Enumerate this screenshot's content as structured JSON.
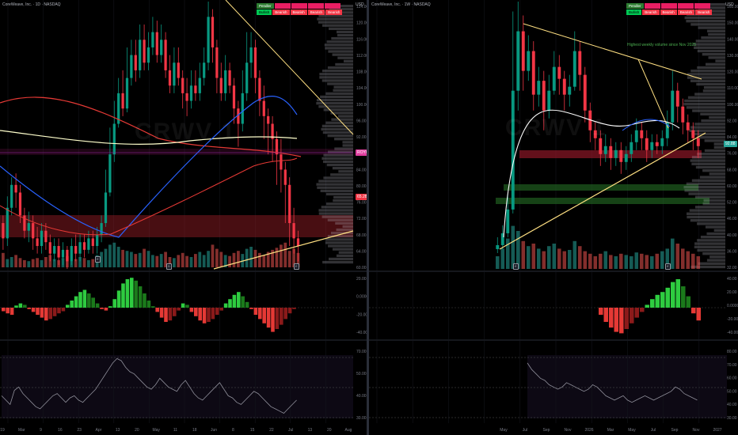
{
  "left": {
    "symbol_title": "CoreWeave, Inc. · 1D · NASDAQ",
    "currency": "USD",
    "watermark": "CRWV 1",
    "trend_panel": {
      "header": [
        "Pendler",
        "",
        "",
        "",
        ""
      ],
      "states": [
        "Bullish",
        "Bearish",
        "Bearish",
        "Bearish",
        "Bearish"
      ]
    },
    "price_ticks": [
      "124.00",
      "120.00",
      "116.00",
      "112.00",
      "108.00",
      "104.00",
      "100.00",
      "96.00",
      "92.00",
      "88.00",
      "84.00",
      "80.00",
      "76.00",
      "72.00",
      "68.00",
      "64.00",
      "60.00"
    ],
    "price_tag_1": "ROYCH",
    "price_tag_2": "65.28",
    "x_labels": [
      "19",
      "Mar",
      "9",
      "16",
      "23",
      "Apr",
      "13",
      "20",
      "May",
      "11",
      "18",
      "Jun",
      "8",
      "15",
      "22",
      "Jul",
      "13",
      "20",
      "Aug"
    ],
    "osc_ticks": [
      "20.00",
      "0.0000",
      "-20.00",
      "-40.00"
    ],
    "rsi_ticks": [
      "70.00",
      "50.00",
      "40.00",
      "30.00"
    ],
    "candles": [
      [
        70,
        66,
        72,
        63
      ],
      [
        66,
        74,
        77,
        64
      ],
      [
        74,
        80,
        82,
        72
      ],
      [
        80,
        78,
        83,
        74
      ],
      [
        78,
        72,
        80,
        70
      ],
      [
        72,
        68,
        74,
        66
      ],
      [
        68,
        70,
        73,
        65
      ],
      [
        70,
        66,
        72,
        63
      ],
      [
        66,
        64,
        69,
        62
      ],
      [
        64,
        68,
        70,
        62
      ],
      [
        68,
        65,
        70,
        63
      ],
      [
        65,
        62,
        67,
        60
      ],
      [
        62,
        64,
        66,
        60
      ],
      [
        64,
        61,
        66,
        59
      ],
      [
        61,
        63,
        65,
        59
      ],
      [
        63,
        60,
        64,
        58
      ],
      [
        60,
        64,
        66,
        59
      ],
      [
        64,
        62,
        67,
        60
      ],
      [
        62,
        65,
        67,
        60
      ],
      [
        65,
        63,
        67,
        61
      ],
      [
        63,
        66,
        68,
        62
      ],
      [
        66,
        64,
        68,
        62
      ],
      [
        64,
        67,
        69,
        62
      ],
      [
        67,
        70,
        72,
        65
      ],
      [
        70,
        78,
        84,
        69
      ],
      [
        78,
        88,
        95,
        77
      ],
      [
        88,
        96,
        102,
        86
      ],
      [
        96,
        104,
        108,
        95
      ],
      [
        104,
        100,
        110,
        98
      ],
      [
        100,
        108,
        116,
        99
      ],
      [
        108,
        114,
        118,
        106
      ],
      [
        114,
        110,
        118,
        107
      ],
      [
        110,
        118,
        122,
        108
      ],
      [
        118,
        112,
        122,
        110
      ],
      [
        112,
        116,
        120,
        110
      ],
      [
        116,
        120,
        124,
        114
      ],
      [
        120,
        114,
        123,
        112
      ],
      [
        114,
        118,
        122,
        112
      ],
      [
        118,
        110,
        120,
        108
      ],
      [
        110,
        106,
        114,
        104
      ],
      [
        106,
        112,
        116,
        104
      ],
      [
        112,
        108,
        116,
        106
      ],
      [
        108,
        104,
        110,
        100
      ],
      [
        104,
        102,
        108,
        98
      ],
      [
        102,
        106,
        110,
        100
      ],
      [
        106,
        104,
        110,
        102
      ],
      [
        104,
        108,
        112,
        102
      ],
      [
        108,
        112,
        116,
        106
      ],
      [
        112,
        124,
        128,
        110
      ],
      [
        124,
        116,
        126,
        112
      ],
      [
        116,
        108,
        118,
        104
      ],
      [
        108,
        104,
        112,
        102
      ],
      [
        104,
        110,
        114,
        102
      ],
      [
        110,
        106,
        112,
        104
      ],
      [
        106,
        100,
        108,
        96
      ],
      [
        100,
        96,
        102,
        90
      ],
      [
        96,
        104,
        110,
        94
      ],
      [
        104,
        112,
        120,
        102
      ],
      [
        112,
        116,
        120,
        108
      ],
      [
        116,
        108,
        118,
        104
      ],
      [
        108,
        102,
        110,
        98
      ],
      [
        102,
        98,
        106,
        92
      ],
      [
        98,
        96,
        100,
        88
      ],
      [
        96,
        92,
        98,
        86
      ],
      [
        92,
        88,
        94,
        80
      ],
      [
        88,
        84,
        92,
        78
      ],
      [
        84,
        80,
        86,
        70
      ],
      [
        80,
        70,
        82,
        64
      ],
      [
        70,
        66,
        74,
        62
      ],
      [
        66,
        64,
        68,
        60
      ]
    ],
    "volume": [
      14,
      8,
      10,
      12,
      9,
      7,
      6,
      8,
      9,
      7,
      10,
      12,
      8,
      7,
      9,
      11,
      6,
      8,
      10,
      9,
      7,
      8,
      12,
      15,
      18,
      22,
      24,
      20,
      17,
      16,
      15,
      13,
      14,
      18,
      16,
      12,
      11,
      13,
      15,
      10,
      9,
      12,
      14,
      11,
      10,
      13,
      15,
      12,
      16,
      22,
      18,
      15,
      12,
      11,
      14,
      16,
      13,
      18,
      20,
      17,
      14,
      12,
      15,
      17,
      19,
      22,
      24,
      16,
      18,
      14
    ],
    "osc": [
      -5,
      -8,
      -10,
      3,
      6,
      4,
      -2,
      -6,
      -10,
      -14,
      -18,
      -16,
      -12,
      -8,
      -5,
      4,
      10,
      16,
      22,
      25,
      20,
      14,
      6,
      -2,
      -4,
      2,
      12,
      24,
      34,
      40,
      42,
      38,
      30,
      20,
      10,
      2,
      -6,
      -14,
      -20,
      -18,
      -12,
      -4,
      6,
      4,
      -6,
      -12,
      -18,
      -22,
      -20,
      -16,
      -10,
      -4,
      6,
      12,
      18,
      22,
      16,
      8,
      -2,
      -10,
      -16,
      -22,
      -28,
      -34,
      -30,
      -24,
      -16,
      -8,
      -2,
      0
    ],
    "rsi": [
      50,
      46,
      42,
      55,
      58,
      52,
      48,
      44,
      40,
      38,
      42,
      46,
      50,
      52,
      48,
      44,
      48,
      50,
      46,
      44,
      48,
      52,
      56,
      62,
      68,
      74,
      80,
      84,
      82,
      76,
      72,
      70,
      66,
      62,
      58,
      56,
      60,
      66,
      62,
      58,
      56,
      54,
      60,
      64,
      58,
      52,
      48,
      46,
      50,
      54,
      58,
      62,
      56,
      50,
      48,
      44,
      42,
      46,
      50,
      54,
      52,
      48,
      44,
      40,
      38,
      36,
      34,
      38,
      42,
      46
    ]
  },
  "right": {
    "symbol_title": "CoreWeave, Inc. · 1W · NASDAQ",
    "currency": "USD",
    "watermark": "CRWV 1",
    "annotation": "Highest weekly volume since Nov 2025",
    "trend_panel": {
      "header": [
        "Pendler",
        "",
        "",
        "",
        ""
      ],
      "states": [
        "Bullish",
        "Bearish",
        "Bearish",
        "Bearish",
        "Bearish"
      ]
    },
    "price_ticks": [
      "160.00",
      "150.00",
      "140.00",
      "130.00",
      "120.00",
      "110.00",
      "100.00",
      "92.00",
      "84.00",
      "76.00",
      "68.00",
      "60.00",
      "52.00",
      "46.00",
      "40.00",
      "36.00",
      "32.00"
    ],
    "price_tag": "92.88",
    "x_labels": [
      "May",
      "Jul",
      "Sep",
      "Nov",
      "2026",
      "Mar",
      "May",
      "Jul",
      "Sep",
      "Nov",
      "2027"
    ],
    "osc_ticks": [
      "40.00",
      "20.00",
      "0.0000",
      "-20.00",
      "-40.00"
    ],
    "rsi_ticks": [
      "80.00",
      "70.00",
      "60.00",
      "50.00",
      "40.00",
      "30.00"
    ],
    "candles": [
      [
        40,
        42,
        46,
        38
      ],
      [
        42,
        48,
        52,
        40
      ],
      [
        48,
        60,
        68,
        46
      ],
      [
        60,
        120,
        160,
        58
      ],
      [
        120,
        150,
        165,
        110
      ],
      [
        150,
        130,
        158,
        120
      ],
      [
        130,
        140,
        148,
        125
      ],
      [
        140,
        118,
        145,
        110
      ],
      [
        118,
        125,
        132,
        112
      ],
      [
        125,
        110,
        130,
        100
      ],
      [
        110,
        120,
        128,
        106
      ],
      [
        120,
        132,
        140,
        118
      ],
      [
        132,
        126,
        138,
        118
      ],
      [
        126,
        118,
        130,
        110
      ],
      [
        118,
        122,
        128,
        112
      ],
      [
        122,
        140,
        150,
        120
      ],
      [
        140,
        128,
        145,
        120
      ],
      [
        128,
        110,
        132,
        104
      ],
      [
        110,
        100,
        114,
        94
      ],
      [
        100,
        96,
        104,
        90
      ],
      [
        96,
        88,
        100,
        82
      ],
      [
        88,
        92,
        98,
        84
      ],
      [
        92,
        86,
        96,
        80
      ],
      [
        86,
        90,
        94,
        82
      ],
      [
        90,
        84,
        94,
        78
      ],
      [
        84,
        88,
        92,
        80
      ],
      [
        88,
        94,
        98,
        84
      ],
      [
        94,
        100,
        106,
        90
      ],
      [
        100,
        96,
        104,
        90
      ],
      [
        96,
        90,
        100,
        84
      ],
      [
        90,
        94,
        98,
        86
      ],
      [
        94,
        92,
        98,
        88
      ],
      [
        92,
        96,
        100,
        88
      ],
      [
        96,
        104,
        110,
        92
      ],
      [
        104,
        120,
        130,
        100
      ],
      [
        120,
        112,
        124,
        104
      ],
      [
        112,
        104,
        116,
        98
      ],
      [
        104,
        100,
        108,
        94
      ],
      [
        100,
        96,
        104,
        90
      ],
      [
        96,
        92,
        100,
        86
      ]
    ],
    "volume": [
      10,
      16,
      24,
      34,
      30,
      22,
      18,
      20,
      16,
      14,
      18,
      20,
      16,
      14,
      15,
      22,
      18,
      14,
      12,
      10,
      12,
      14,
      11,
      10,
      12,
      11,
      10,
      13,
      12,
      11,
      10,
      12,
      14,
      16,
      24,
      20,
      16,
      14,
      12,
      10
    ],
    "osc": [
      0,
      0,
      0,
      0,
      0,
      0,
      0,
      0,
      0,
      0,
      0,
      0,
      0,
      0,
      0,
      0,
      0,
      0,
      0,
      0,
      -10,
      -20,
      -28,
      -34,
      -36,
      -30,
      -22,
      -14,
      -6,
      4,
      12,
      18,
      22,
      28,
      36,
      40,
      30,
      16,
      -8,
      -18
    ],
    "rsi": [
      80,
      74,
      70,
      66,
      64,
      60,
      58,
      56,
      58,
      62,
      60,
      58,
      56,
      54,
      56,
      60,
      58,
      54,
      50,
      48,
      46,
      48,
      50,
      46,
      44,
      46,
      48,
      50,
      48,
      46,
      48,
      50,
      52,
      54,
      58,
      56,
      52,
      50,
      48,
      46
    ]
  }
}
